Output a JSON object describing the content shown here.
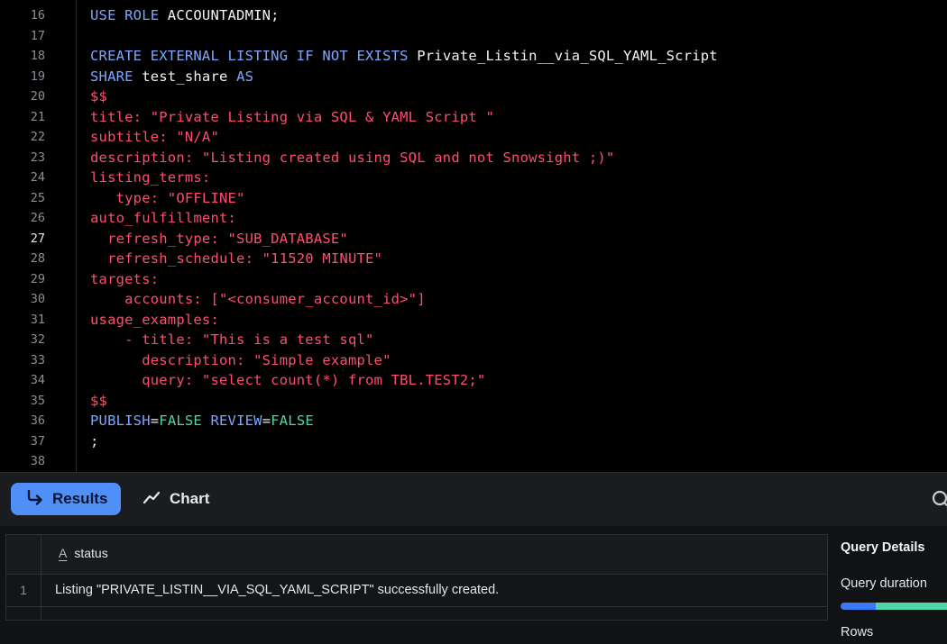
{
  "editor": {
    "active_line": "27",
    "lines": [
      {
        "n": "16",
        "tokens": [
          [
            "kw",
            "USE ROLE "
          ],
          [
            "id",
            "ACCOUNTADMIN;"
          ]
        ]
      },
      {
        "n": "17",
        "tokens": []
      },
      {
        "n": "18",
        "tokens": [
          [
            "kw",
            "CREATE EXTERNAL LISTING IF NOT EXISTS "
          ],
          [
            "id",
            "Private_Listin__via_SQL_YAML_Script"
          ]
        ]
      },
      {
        "n": "19",
        "tokens": [
          [
            "kw",
            "SHARE "
          ],
          [
            "id",
            "test_share "
          ],
          [
            "kw",
            "AS"
          ]
        ]
      },
      {
        "n": "20",
        "tokens": [
          [
            "str",
            "$$"
          ]
        ]
      },
      {
        "n": "21",
        "tokens": [
          [
            "str",
            "title: \"Private Listing via SQL & YAML Script \""
          ]
        ]
      },
      {
        "n": "22",
        "tokens": [
          [
            "str",
            "subtitle: \"N/A\""
          ]
        ]
      },
      {
        "n": "23",
        "tokens": [
          [
            "str",
            "description: \"Listing created using SQL and not Snowsight ;)\""
          ]
        ]
      },
      {
        "n": "24",
        "tokens": [
          [
            "str",
            "listing_terms:"
          ]
        ]
      },
      {
        "n": "25",
        "tokens": [
          [
            "str",
            "   type: \"OFFLINE\""
          ]
        ]
      },
      {
        "n": "26",
        "tokens": [
          [
            "str",
            "auto_fulfillment:"
          ]
        ]
      },
      {
        "n": "27",
        "tokens": [
          [
            "str",
            "  refresh_type: \"SUB_DATABASE\""
          ]
        ]
      },
      {
        "n": "28",
        "tokens": [
          [
            "str",
            "  refresh_schedule: \"11520 MINUTE\""
          ]
        ]
      },
      {
        "n": "29",
        "tokens": [
          [
            "str",
            "targets:"
          ]
        ]
      },
      {
        "n": "30",
        "tokens": [
          [
            "str",
            "    accounts: [\"<consumer_account_id>\"]"
          ]
        ]
      },
      {
        "n": "31",
        "tokens": [
          [
            "str",
            "usage_examples:"
          ]
        ]
      },
      {
        "n": "32",
        "tokens": [
          [
            "str",
            "    - title: \"This is a test sql\""
          ]
        ]
      },
      {
        "n": "33",
        "tokens": [
          [
            "str",
            "      description: \"Simple example\""
          ]
        ]
      },
      {
        "n": "34",
        "tokens": [
          [
            "str",
            "      query: \"select count(*) from TBL.TEST2;\""
          ]
        ]
      },
      {
        "n": "35",
        "tokens": [
          [
            "str",
            "$$"
          ]
        ]
      },
      {
        "n": "36",
        "tokens": [
          [
            "kw",
            "PUBLISH"
          ],
          [
            "punc",
            "="
          ],
          [
            "bool",
            "FALSE "
          ],
          [
            "kw",
            "REVIEW"
          ],
          [
            "punc",
            "="
          ],
          [
            "bool",
            "FALSE"
          ]
        ]
      },
      {
        "n": "37",
        "tokens": [
          [
            "punc",
            ";"
          ]
        ]
      },
      {
        "n": "38",
        "tokens": []
      }
    ]
  },
  "toolbar": {
    "results_label": "Results",
    "chart_label": "Chart",
    "accent": "#4f8ff7"
  },
  "table": {
    "columns": [
      {
        "type_icon": "A",
        "name": "status"
      }
    ],
    "rows": [
      {
        "index": "1",
        "status": "Listing \"PRIVATE_LISTIN__VIA_SQL_YAML_SCRIPT\" successfully created."
      }
    ]
  },
  "details": {
    "title": "Query Details",
    "duration_label": "Query duration",
    "rows_label": "Rows"
  }
}
